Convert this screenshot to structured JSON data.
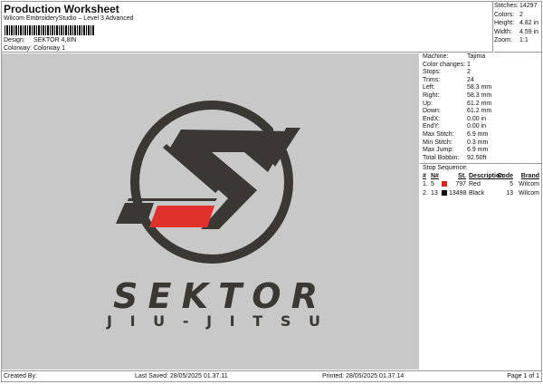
{
  "header": {
    "title": "Production Worksheet",
    "subtitle": "Wilcom EmbroideryStudio – Level 3 Advanced",
    "design_label": "Design:",
    "design_value": "SEKTOR 4,8IN",
    "colorway_label": "Colorway:",
    "colorway_value": "Colorway 1"
  },
  "stats": [
    {
      "label": "Stitches:",
      "value": "14297"
    },
    {
      "label": "Colors:",
      "value": "2"
    },
    {
      "label": "Height:",
      "value": "4.82 in"
    },
    {
      "label": "Width:",
      "value": "4.59 in"
    },
    {
      "label": "Zoom:",
      "value": "1:1"
    }
  ],
  "design": {
    "logo_text": "SEKTOR",
    "logo_sub": "JIU-JITSU",
    "colors": {
      "thread_dark": "#3b3834",
      "thread_red": "#e0312c",
      "background": "#c8c8c8"
    }
  },
  "machine": [
    {
      "label": "Machine:",
      "value": "Tajima"
    },
    {
      "label": "Color changes:",
      "value": "1"
    },
    {
      "label": "Stops:",
      "value": "2"
    },
    {
      "label": "Trims:",
      "value": "24"
    },
    {
      "label": "Left:",
      "value": "58.3 mm"
    },
    {
      "label": "Right:",
      "value": "58.3 mm"
    },
    {
      "label": "Up:",
      "value": "61.2 mm"
    },
    {
      "label": "Down:",
      "value": "61.2 mm"
    },
    {
      "label": "EndX:",
      "value": "0.00 in"
    },
    {
      "label": "EndY:",
      "value": "0.00 in"
    },
    {
      "label": "Max Stitch:",
      "value": "6.9 mm"
    },
    {
      "label": "Min Stitch:",
      "value": "0.3 mm"
    },
    {
      "label": "Max Jump:",
      "value": "6.9 mm"
    },
    {
      "label": "Total Bobbin:",
      "value": "92.50ft"
    }
  ],
  "stop_sequence": {
    "title": "Stop Sequence:",
    "headers": [
      "#",
      "N#",
      "St.",
      "Description",
      "Code",
      "Brand"
    ],
    "rows": [
      {
        "num": "1.",
        "n": "5",
        "color": "#e0201c",
        "st": "797",
        "desc": "Red",
        "code": "5",
        "brand": "Wilcom"
      },
      {
        "num": "2.",
        "n": "13",
        "color": "#111111",
        "st": "13498",
        "desc": "Black",
        "code": "13",
        "brand": "Wilcom"
      }
    ]
  },
  "footer": {
    "created": "Created By:",
    "saved": "Last Saved: 28/05/2025 01.37.11",
    "printed": "Printed: 28/05/2025 01.37.14",
    "page": "Page 1 of 1"
  }
}
